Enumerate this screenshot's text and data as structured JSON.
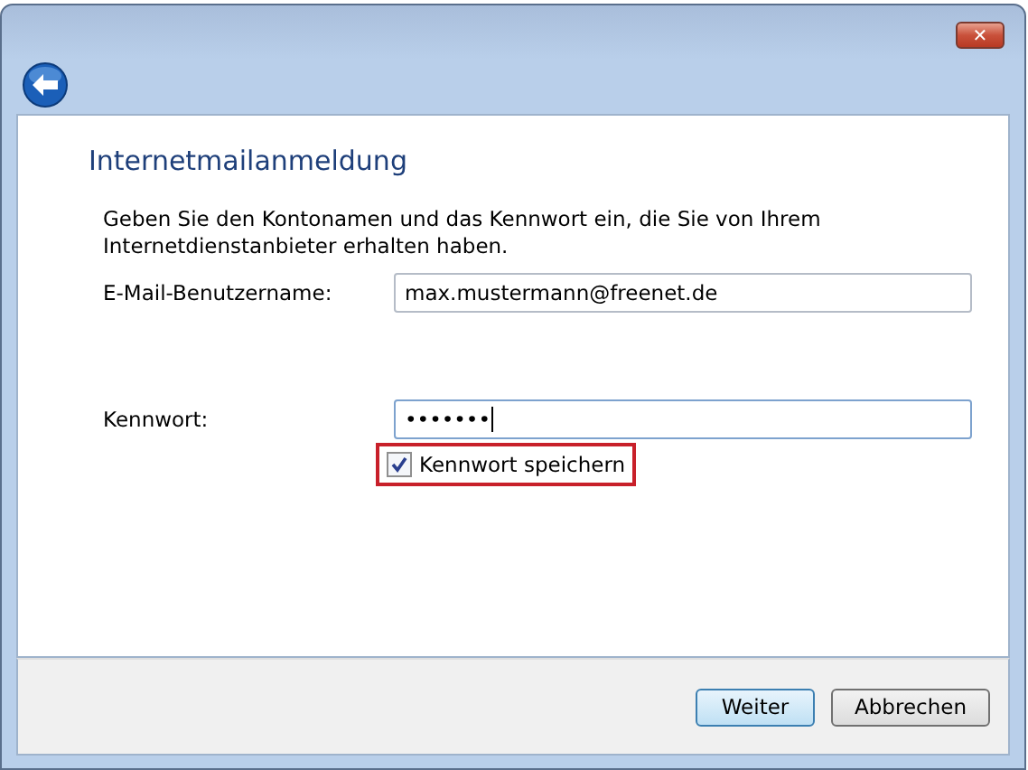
{
  "window": {
    "close_label": "✕"
  },
  "title": "Internetmailanmeldung",
  "description": "Geben Sie den Kontonamen und das Kennwort ein, die Sie von Ihrem Internetdienstanbieter erhalten haben.",
  "fields": [
    {
      "label": "E-Mail-Benutzername:",
      "value": "max.mustermann@freenet.de",
      "focused": false
    },
    {
      "label": "Kennwort:",
      "value": "•••••••",
      "focused": true
    }
  ],
  "remember": {
    "label": "Kennwort speichern",
    "checked": true,
    "highlighted": true
  },
  "buttons": [
    {
      "label": "Weiter",
      "default": true
    },
    {
      "label": "Abbrechen",
      "default": false
    }
  ]
}
